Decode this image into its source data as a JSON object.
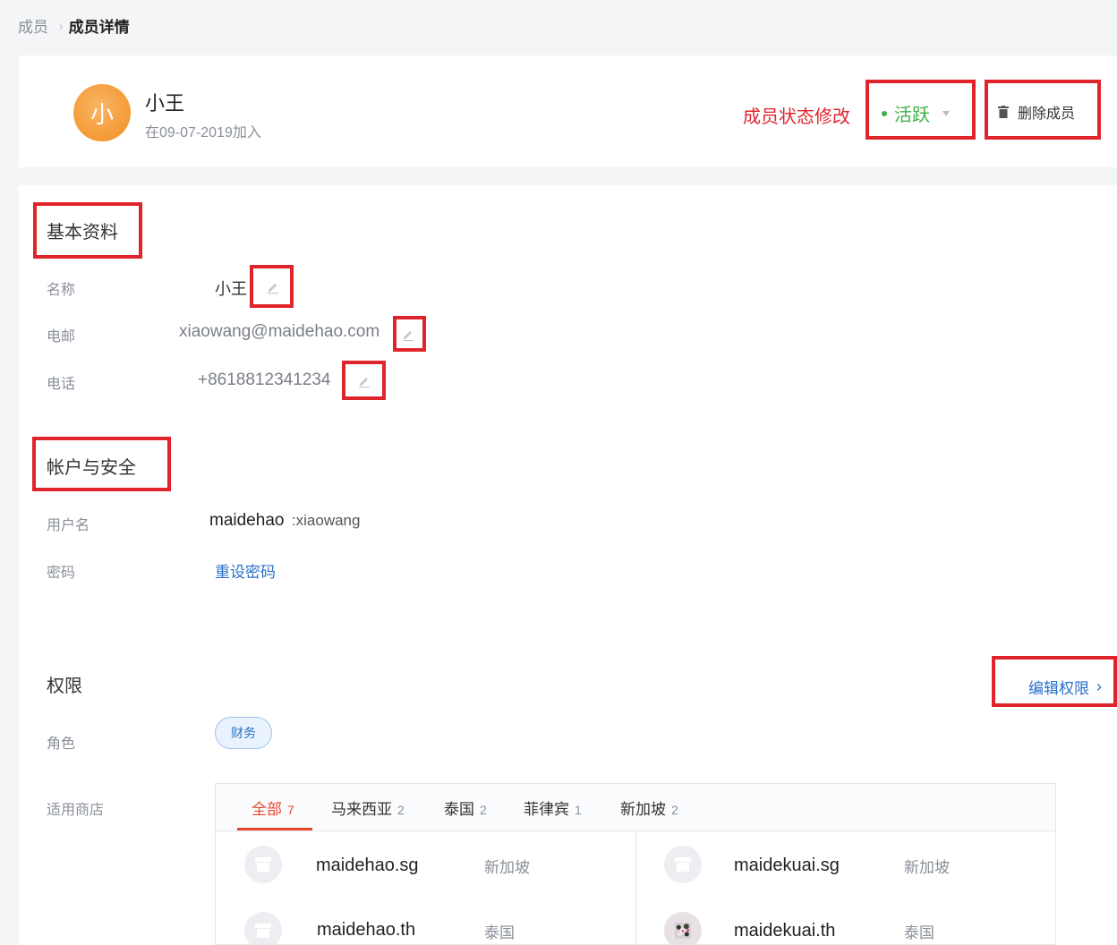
{
  "breadcrumb": {
    "root": "成员",
    "current": "成员详情"
  },
  "member": {
    "avatar_letter": "小",
    "name": "小王",
    "joined": "在09-07-2019加入"
  },
  "header": {
    "status_hint": "成员状态修改",
    "status_value": "活跃",
    "delete_label": "删除成员"
  },
  "basic": {
    "title": "基本资料",
    "name_label": "名称",
    "name_value": "小王",
    "email_label": "电邮",
    "email_value": "xiaowang@maidehao.com",
    "phone_label": "电话",
    "phone_value": "+8618812341234"
  },
  "account": {
    "title": "帐户与安全",
    "username_label": "用户名",
    "username_prefix": "maidehao",
    "username_suffix": ":xiaowang",
    "password_label": "密码",
    "reset_password": "重设密码"
  },
  "permissions": {
    "title": "权限",
    "edit_link": "编辑权限",
    "role_label": "角色",
    "role_value": "财务",
    "stores_label": "适用商店"
  },
  "store_tabs": [
    {
      "label": "全部",
      "count": "7"
    },
    {
      "label": "马来西亚",
      "count": "2"
    },
    {
      "label": "泰国",
      "count": "2"
    },
    {
      "label": "菲律宾",
      "count": "1"
    },
    {
      "label": "新加坡",
      "count": "2"
    }
  ],
  "stores": [
    {
      "name": "maidehao.sg",
      "country": "新加坡",
      "logo": "store-icon"
    },
    {
      "name": "maidekuai.sg",
      "country": "新加坡",
      "logo": "store-icon"
    },
    {
      "name": "maidehao.th",
      "country": "泰国",
      "logo": "store-icon"
    },
    {
      "name": "maidekuai.th",
      "country": "泰国",
      "logo": "flower-photo"
    }
  ],
  "colors": {
    "accent_red": "#e0242c",
    "active_green": "#3cb043",
    "link_blue": "#2a6fc9",
    "avatar_orange": "#f49a35",
    "tab_active": "#e8452c"
  }
}
